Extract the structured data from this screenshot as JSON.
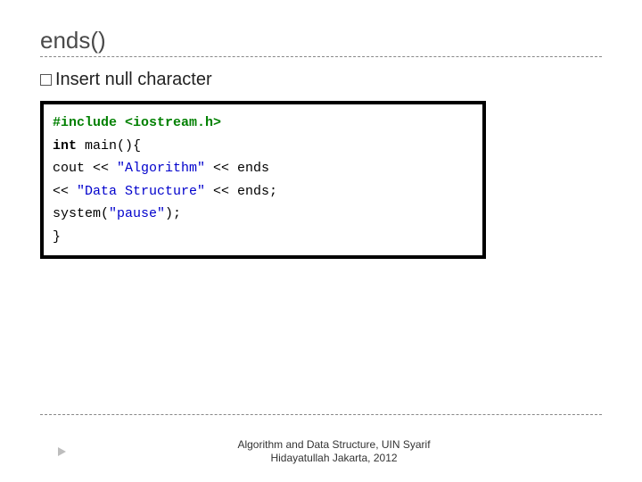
{
  "title": "ends()",
  "bullet": "Insert null character",
  "code": {
    "line1": "#include <iostream.h>",
    "blank1": " ",
    "kw_int": "int",
    "main_open": " main(){",
    "blank2": " ",
    "cout_indent": "    cout << ",
    "str_algo": "\"Algorithm\"",
    "ends1": " << ends",
    "cont_indent": "         << ",
    "str_ds": "\"Data Structure\"",
    "ends2": " << ends;",
    "blank3": " ",
    "sys_indent": "    system(",
    "str_pause": "\"pause\"",
    "sys_close": ");",
    "close_brace": "}"
  },
  "footer_line1": "Algorithm and Data Structure, UIN Syarif",
  "footer_line2": "Hidayatullah Jakarta, 2012"
}
